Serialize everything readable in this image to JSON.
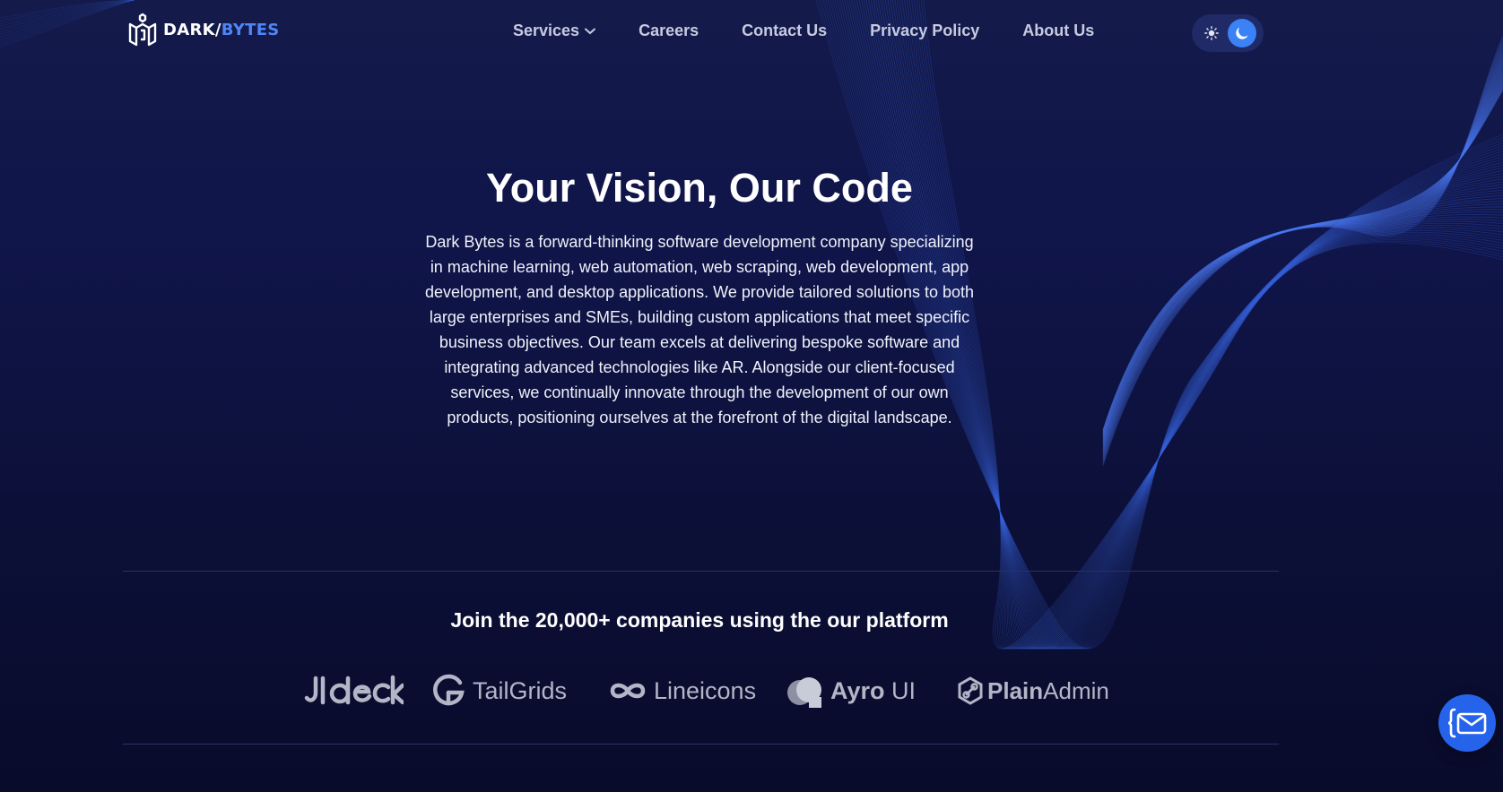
{
  "brand": {
    "dark": "DARK/",
    "bytes": "BYTES",
    "logo_icon": "cube-logo-icon"
  },
  "nav": {
    "items": [
      {
        "label": "Services",
        "has_dropdown": true,
        "icon": "chevron-down-icon"
      },
      {
        "label": "Careers"
      },
      {
        "label": "Contact Us"
      },
      {
        "label": "Privacy Policy"
      },
      {
        "label": "About Us"
      }
    ]
  },
  "theme_toggle": {
    "icons": [
      "sun-icon",
      "moon-icon"
    ],
    "active": "dark"
  },
  "hero": {
    "title": "Your Vision, Our Code",
    "description": "Dark Bytes is a forward-thinking software development company specializing in machine learning, web automation, web scraping, web development, app development, and desktop applications. We provide tailored solutions to both large enterprises and SMEs, building custom applications that meet specific business objectives. Our team excels at delivering bespoke software and integrating advanced technologies like AR. Alongside our client-focused services, we continually innovate through the development of our own products, positioning ourselves at the forefront of the digital landscape."
  },
  "companies": {
    "title": "Join the 20,000+ companies using the our platform",
    "logos": [
      {
        "name": "Uideck",
        "icon": "uideck-logo"
      },
      {
        "name": "TailGrids",
        "icon": "tailgrids-logo-icon"
      },
      {
        "name": "Lineicons",
        "icon": "infinity-icon"
      },
      {
        "name_main": "Ayro",
        "name_suffix": " UI",
        "icon": "ayro-logo-icon"
      },
      {
        "name_main": "Plain",
        "name_suffix": "Admin",
        "icon": "plainadmin-logo-icon"
      }
    ]
  },
  "contact_fab": {
    "icon": "mail-braces-icon"
  },
  "colors": {
    "accent": "#3b82f6",
    "background": "#0c1038",
    "logo_accent": "#4f86f7",
    "nav_text": "#c6cbe0"
  }
}
